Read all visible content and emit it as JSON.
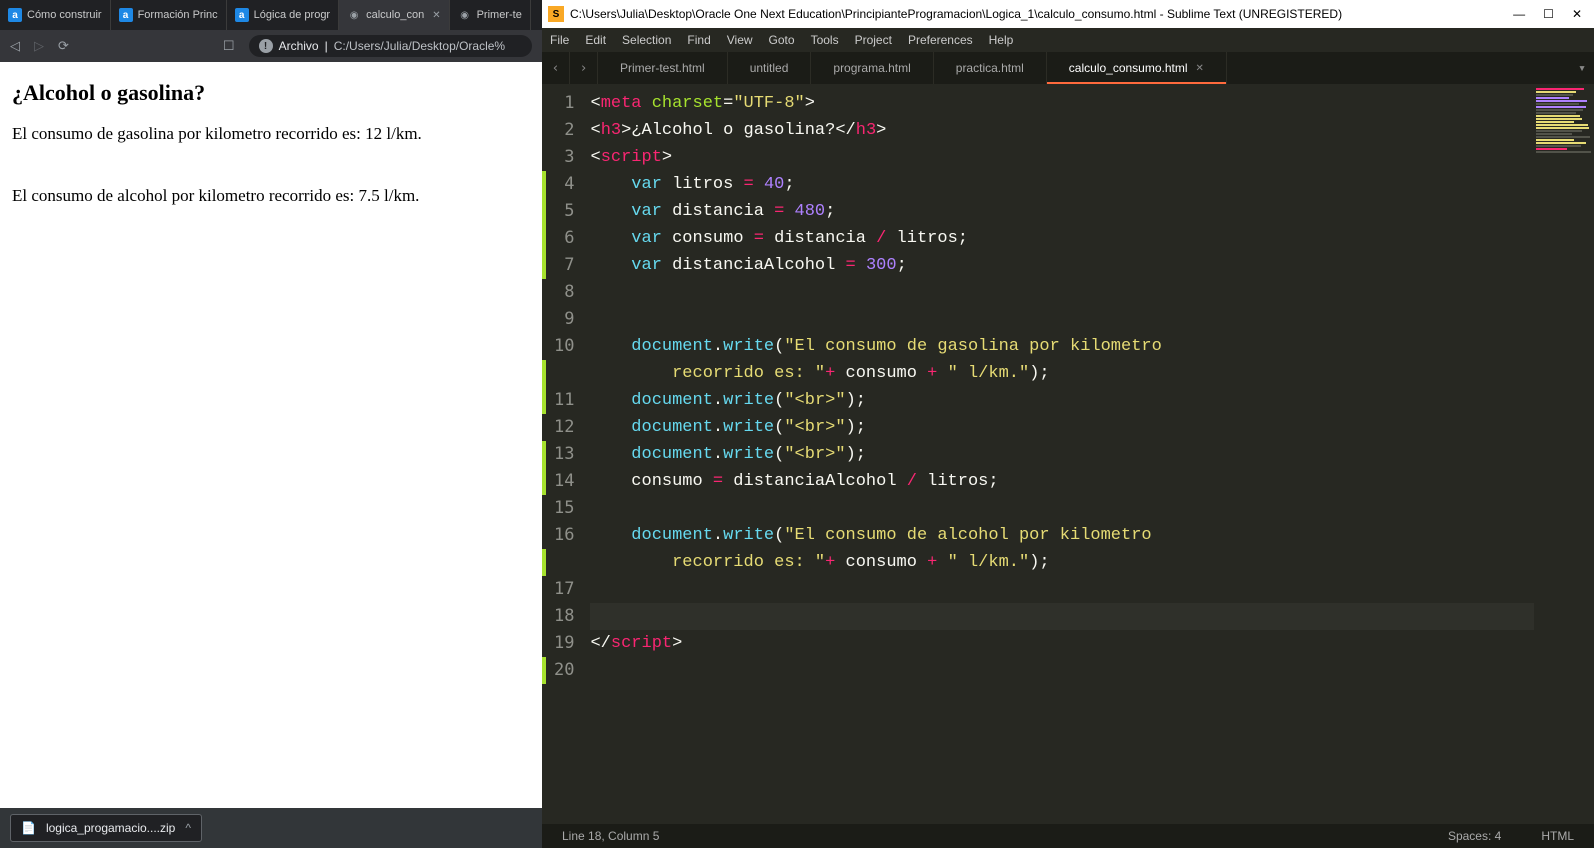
{
  "browser": {
    "tabs": [
      {
        "label": "Cómo construir",
        "favtype": "a"
      },
      {
        "label": "Formación Princ",
        "favtype": "a"
      },
      {
        "label": "Lógica de progr",
        "favtype": "a"
      },
      {
        "label": "calculo_con",
        "favtype": "globe",
        "active": true
      },
      {
        "label": "Primer-te",
        "favtype": "globe"
      }
    ],
    "url_label": "Archivo",
    "url_path": "C:/Users/Julia/Desktop/Oracle%",
    "page": {
      "heading": "¿Alcohol o gasolina?",
      "line_gas": "El consumo de gasolina por kilometro recorrido es: 12 l/km.",
      "line_alc": "El consumo de alcohol por kilometro recorrido es: 7.5 l/km."
    },
    "download_name": "logica_progamacio....zip"
  },
  "sublime": {
    "title_path": "C:\\Users\\Julia\\Desktop\\Oracle One Next Education\\PrincipianteProgramacion\\Logica_1\\calculo_consumo.html - Sublime Text (UNREGISTERED)",
    "menus": [
      "File",
      "Edit",
      "Selection",
      "Find",
      "View",
      "Goto",
      "Tools",
      "Project",
      "Preferences",
      "Help"
    ],
    "tabs": [
      "Primer-test.html",
      "untitled",
      "programa.html",
      "practica.html",
      "calculo_consumo.html"
    ],
    "active_tab": 4,
    "status_left": "Line 18, Column 5",
    "status_spaces": "Spaces: 4",
    "status_lang": "HTML",
    "code": {
      "line_numbers": [
        "1",
        "2",
        "3",
        "4",
        "5",
        "6",
        "7",
        "8",
        "9",
        "10",
        "",
        "11",
        "12",
        "13",
        "14",
        "15",
        "16",
        "",
        "17",
        "18",
        "19",
        "20"
      ],
      "mod_lines": [
        3,
        4,
        5,
        6,
        10,
        11,
        13,
        14,
        17,
        21
      ],
      "caret_row": 19,
      "tokens": [
        [
          [
            "<",
            "w"
          ],
          [
            "meta",
            "r"
          ],
          [
            " ",
            "w"
          ],
          [
            "charset",
            "g"
          ],
          [
            "=",
            "w"
          ],
          [
            "\"UTF-8\"",
            "y"
          ],
          [
            ">",
            "w"
          ]
        ],
        [
          [
            "<",
            "w"
          ],
          [
            "h3",
            "r"
          ],
          [
            ">",
            "w"
          ],
          [
            "¿Alcohol o gasolina?",
            "w"
          ],
          [
            "</",
            "w"
          ],
          [
            "h3",
            "r"
          ],
          [
            ">",
            "w"
          ]
        ],
        [
          [
            "<",
            "w"
          ],
          [
            "script",
            "r"
          ],
          [
            ">",
            "w"
          ]
        ],
        [
          [
            "    ",
            "w"
          ],
          [
            "var",
            "c"
          ],
          [
            " litros ",
            "w"
          ],
          [
            "=",
            "r"
          ],
          [
            " ",
            "w"
          ],
          [
            "40",
            "p"
          ],
          [
            ";",
            "w"
          ]
        ],
        [
          [
            "    ",
            "w"
          ],
          [
            "var",
            "c"
          ],
          [
            " distancia ",
            "w"
          ],
          [
            "=",
            "r"
          ],
          [
            " ",
            "w"
          ],
          [
            "480",
            "p"
          ],
          [
            ";",
            "w"
          ]
        ],
        [
          [
            "    ",
            "w"
          ],
          [
            "var",
            "c"
          ],
          [
            " consumo ",
            "w"
          ],
          [
            "=",
            "r"
          ],
          [
            " distancia ",
            "w"
          ],
          [
            "/",
            "r"
          ],
          [
            " litros;",
            "w"
          ]
        ],
        [
          [
            "    ",
            "w"
          ],
          [
            "var",
            "c"
          ],
          [
            " distanciaAlcohol ",
            "w"
          ],
          [
            "=",
            "r"
          ],
          [
            " ",
            "w"
          ],
          [
            "300",
            "p"
          ],
          [
            ";",
            "w"
          ]
        ],
        [
          [
            "",
            "w"
          ]
        ],
        [
          [
            "",
            "w"
          ]
        ],
        [
          [
            "    ",
            "w"
          ],
          [
            "document",
            "c"
          ],
          [
            ".",
            "w"
          ],
          [
            "write",
            "c"
          ],
          [
            "(",
            "w"
          ],
          [
            "\"El consumo de gasolina por kilometro ",
            "y"
          ]
        ],
        [
          [
            "        recorrido es: \"",
            "y"
          ],
          [
            "+",
            "r"
          ],
          [
            " consumo ",
            "w"
          ],
          [
            "+",
            "r"
          ],
          [
            " ",
            "w"
          ],
          [
            "\" l/km.\"",
            "y"
          ],
          [
            ");",
            "w"
          ]
        ],
        [
          [
            "    ",
            "w"
          ],
          [
            "document",
            "c"
          ],
          [
            ".",
            "w"
          ],
          [
            "write",
            "c"
          ],
          [
            "(",
            "w"
          ],
          [
            "\"<br>\"",
            "y"
          ],
          [
            ");",
            "w"
          ]
        ],
        [
          [
            "    ",
            "w"
          ],
          [
            "document",
            "c"
          ],
          [
            ".",
            "w"
          ],
          [
            "write",
            "c"
          ],
          [
            "(",
            "w"
          ],
          [
            "\"<br>\"",
            "y"
          ],
          [
            ");",
            "w"
          ]
        ],
        [
          [
            "    ",
            "w"
          ],
          [
            "document",
            "c"
          ],
          [
            ".",
            "w"
          ],
          [
            "write",
            "c"
          ],
          [
            "(",
            "w"
          ],
          [
            "\"<br>\"",
            "y"
          ],
          [
            ");",
            "w"
          ]
        ],
        [
          [
            "    consumo ",
            "w"
          ],
          [
            "=",
            "r"
          ],
          [
            " distanciaAlcohol ",
            "w"
          ],
          [
            "/",
            "r"
          ],
          [
            " litros;",
            "w"
          ]
        ],
        [
          [
            "",
            "w"
          ]
        ],
        [
          [
            "    ",
            "w"
          ],
          [
            "document",
            "c"
          ],
          [
            ".",
            "w"
          ],
          [
            "write",
            "c"
          ],
          [
            "(",
            "w"
          ],
          [
            "\"El consumo de alcohol por kilometro ",
            "y"
          ]
        ],
        [
          [
            "        recorrido es: \"",
            "y"
          ],
          [
            "+",
            "r"
          ],
          [
            " consumo ",
            "w"
          ],
          [
            "+",
            "r"
          ],
          [
            " ",
            "w"
          ],
          [
            "\" l/km.\"",
            "y"
          ],
          [
            ");",
            "w"
          ]
        ],
        [
          [
            "",
            "w"
          ]
        ],
        [
          [
            "    ",
            "w"
          ]
        ],
        [
          [
            "</",
            "w"
          ],
          [
            "script",
            "r"
          ],
          [
            ">",
            "w"
          ]
        ],
        [
          [
            "",
            "w"
          ]
        ]
      ]
    }
  }
}
